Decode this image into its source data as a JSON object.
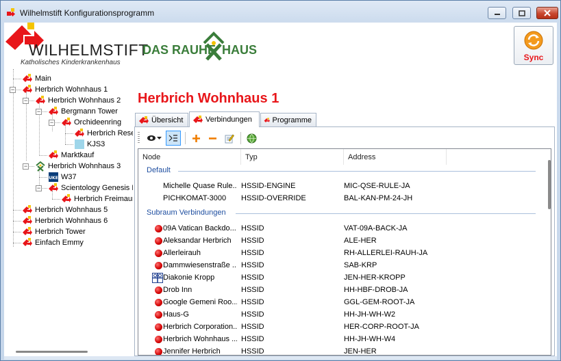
{
  "window": {
    "title": "Wilhelmstift Konfigurationsprogramm"
  },
  "logos": {
    "wilhelmstift": "WILHELMSTIFT",
    "wilhelmstift_sub": "Katholisches Kinderkrankenhaus",
    "rauhe_left": "DAS RAUHE",
    "rauhe_right": "HAUS"
  },
  "sync": {
    "label": "Sync"
  },
  "tree": [
    {
      "label": "Main",
      "icon": "wilhelmstift-icon"
    },
    {
      "label": "Herbrich Wohnhaus 1",
      "icon": "wilhelmstift-icon"
    },
    {
      "label": "Herbrich Wohnhaus 2",
      "icon": "wilhelmstift-icon"
    },
    {
      "label": "Bergmann Tower",
      "icon": "wilhelmstift-icon"
    },
    {
      "label": "Orchideenring",
      "icon": "wilhelmstift-icon"
    },
    {
      "label": "Herbrich Rese",
      "icon": "wilhelmstift-icon"
    },
    {
      "label": "KJS3",
      "icon": "folder-blue-icon"
    },
    {
      "label": "Marktkauf",
      "icon": "wilhelmstift-icon"
    },
    {
      "label": "Herbrich Wohnhaus 3",
      "icon": "rauhe-haus-icon"
    },
    {
      "label": "W37",
      "icon": "uke-icon"
    },
    {
      "label": "Scientology Genesis N",
      "icon": "wilhelmstift-icon"
    },
    {
      "label": "Herbrich Freimaure",
      "icon": "wilhelmstift-icon"
    },
    {
      "label": "Herbrich Wohnhaus 5",
      "icon": "wilhelmstift-icon"
    },
    {
      "label": "Herbrich Wohnhaus 6",
      "icon": "wilhelmstift-icon"
    },
    {
      "label": "Herbrich Tower",
      "icon": "wilhelmstift-icon"
    },
    {
      "label": "Einfach Emmy",
      "icon": "wilhelmstift-icon"
    }
  ],
  "main": {
    "heading": "Herbrich Wohnhaus 1",
    "tabs": [
      {
        "label": "Übersicht"
      },
      {
        "label": "Verbindungen"
      },
      {
        "label": "Programme"
      }
    ],
    "columns": {
      "node": "Node",
      "typ": "Typ",
      "address": "Address"
    },
    "groups": [
      {
        "title": "Default",
        "rows": [
          {
            "node": "Michelle Quase Rule...",
            "typ": "HSSID-ENGINE",
            "address": "MIC-QSE-RULE-JA",
            "icon": ""
          },
          {
            "node": "PICHKOMAT-3000",
            "typ": "HSSID-OVERRIDE",
            "address": "BAL-KAN-PM-24-JH",
            "icon": ""
          }
        ]
      },
      {
        "title": "Subraum Verbindungen",
        "rows": [
          {
            "node": "09A Vatican Backdo...",
            "typ": "HSSID",
            "address": "VAT-09A-BACK-JA",
            "icon": "red-dot-icon"
          },
          {
            "node": "Aleksandar Herbrich",
            "typ": "HSSID",
            "address": "ALE-HER",
            "icon": "red-dot-icon"
          },
          {
            "node": "Allerleirauh",
            "typ": "HSSID",
            "address": "RH-ALLERLEI-RAUH-JA",
            "icon": "red-dot-icon"
          },
          {
            "node": "Dammwiesenstraße ...",
            "typ": "HSSID",
            "address": "SAB-KRP",
            "icon": "red-dot-icon"
          },
          {
            "node": "Diakonie Kropp",
            "typ": "HSSID",
            "address": "JEN-HER-KROPP",
            "icon": "diakonie-icon"
          },
          {
            "node": "Drob Inn",
            "typ": "HSSID",
            "address": "HH-HBF-DROB-JA",
            "icon": "red-dot-icon"
          },
          {
            "node": "Google Gemeni Roo...",
            "typ": "HSSID",
            "address": "GGL-GEM-ROOT-JA",
            "icon": "red-dot-icon"
          },
          {
            "node": "Haus-G",
            "typ": "HSSID",
            "address": "HH-JH-WH-W2",
            "icon": "red-dot-icon"
          },
          {
            "node": "Herbrich Corporation...",
            "typ": "HSSID",
            "address": "HER-CORP-ROOT-JA",
            "icon": "red-dot-icon"
          },
          {
            "node": "Herbrich Wohnhaus ...",
            "typ": "HSSID",
            "address": "HH-JH-WH-W4",
            "icon": "red-dot-icon"
          },
          {
            "node": "Jennifer Herbrich",
            "typ": "HSSID",
            "address": "JEN-HER",
            "icon": "red-dot-icon"
          }
        ]
      }
    ]
  },
  "colors": {
    "accent_red": "#e8161a",
    "rauhe_green": "#3a7d3a",
    "group_blue": "#1e4ea0"
  }
}
